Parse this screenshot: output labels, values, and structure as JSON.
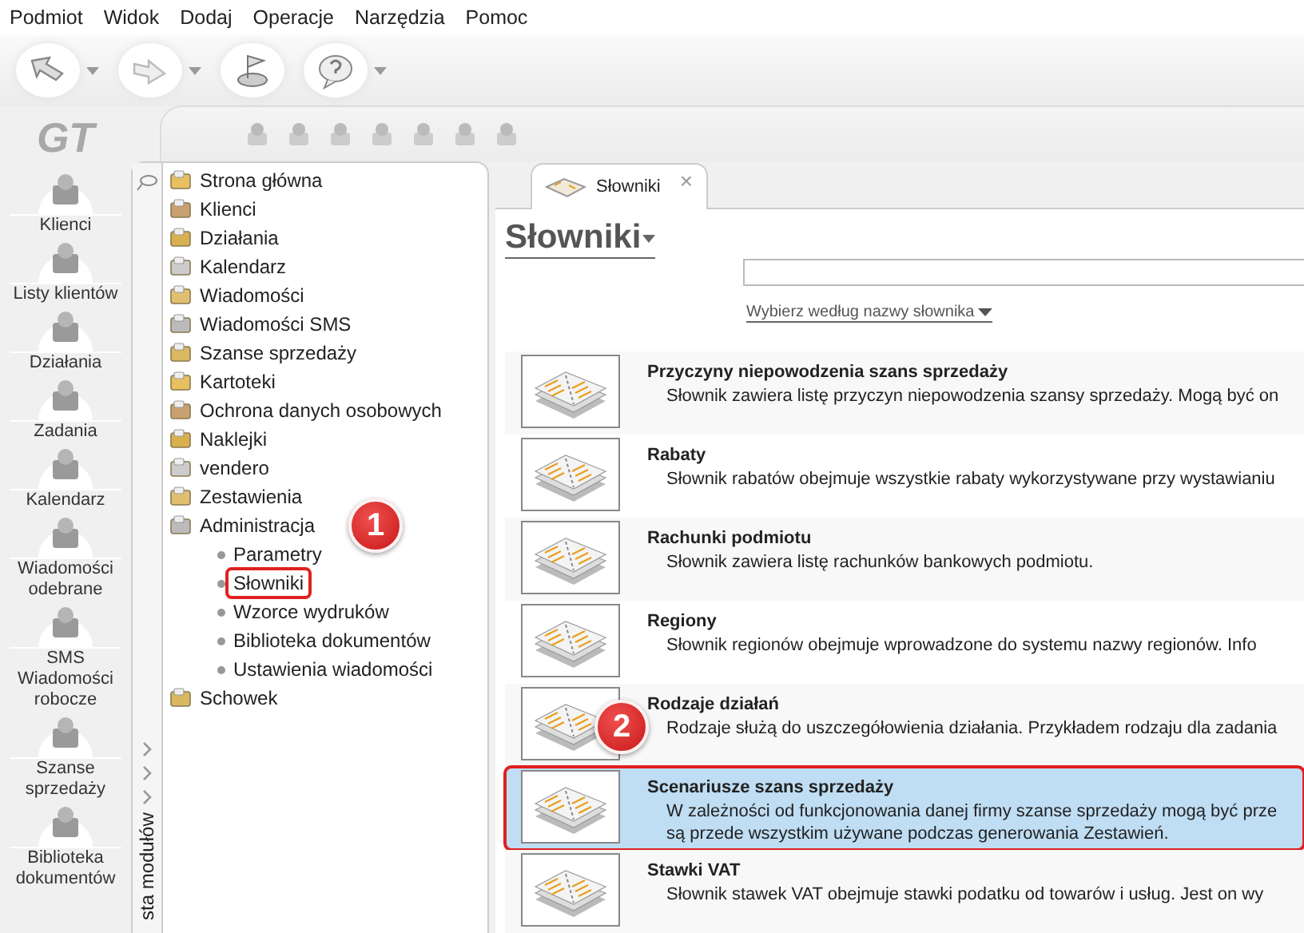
{
  "menu": [
    "Podmiot",
    "Widok",
    "Dodaj",
    "Operacje",
    "Narzędzia",
    "Pomoc"
  ],
  "toolbar": [
    {
      "dropdown": true
    },
    {
      "dropdown": true
    },
    {
      "dropdown": false
    },
    {
      "dropdown": true
    }
  ],
  "logo": "GT",
  "rail": [
    "Klienci",
    "Listy klientów",
    "Działania",
    "Zadania",
    "Kalendarz",
    "Wiadomości odebrane",
    "SMS Wiadomości robocze",
    "Szanse sprzedaży",
    "Biblioteka dokumentów"
  ],
  "module_strip": {
    "label": "sta modułów"
  },
  "tree": [
    {
      "label": "Strona główna"
    },
    {
      "label": "Klienci"
    },
    {
      "label": "Działania"
    },
    {
      "label": "Kalendarz"
    },
    {
      "label": "Wiadomości"
    },
    {
      "label": "Wiadomości SMS"
    },
    {
      "label": "Szanse sprzedaży"
    },
    {
      "label": "Kartoteki"
    },
    {
      "label": "Ochrona danych osobowych"
    },
    {
      "label": "Naklejki"
    },
    {
      "label": "vendero"
    },
    {
      "label": "Zestawienia"
    },
    {
      "label": "Administracja",
      "badge": "1",
      "children": [
        {
          "label": "Parametry",
          "outlined": false
        },
        {
          "label": "Słowniki",
          "outlined": true
        },
        {
          "label": "Wzorce wydruków",
          "outlined": false
        },
        {
          "label": "Biblioteka dokumentów",
          "outlined": false
        },
        {
          "label": "Ustawienia wiadomości",
          "outlined": false
        }
      ]
    },
    {
      "label": "Schowek"
    }
  ],
  "tab": {
    "label": "Słowniki",
    "close": "×"
  },
  "heading": "Słowniki",
  "filter": {
    "label": "Wybierz według nazwy słownika"
  },
  "dictionaries": [
    {
      "title": "Przyczyny niepowodzenia szans sprzedaży",
      "description": [
        "Słownik zawiera listę przyczyn niepowodzenia szansy sprzedaży. Mogą być on"
      ],
      "selected": false,
      "outlined": false
    },
    {
      "title": "Rabaty",
      "description": [
        "Słownik rabatów obejmuje wszystkie rabaty wykorzystywane przy wystawianiu"
      ],
      "selected": false,
      "outlined": false
    },
    {
      "title": "Rachunki podmiotu",
      "description": [
        "Słownik zawiera listę rachunków bankowych podmiotu."
      ],
      "selected": false,
      "outlined": false
    },
    {
      "title": "Regiony",
      "description": [
        "Słownik regionów obejmuje wprowadzone do systemu nazwy regionów. Info"
      ],
      "selected": false,
      "outlined": false
    },
    {
      "title": "Rodzaje działań",
      "description": [
        "Rodzaje służą do uszczegółowienia działania. Przykładem rodzaju dla zadania"
      ],
      "selected": false,
      "outlined": false,
      "badge": "2"
    },
    {
      "title": "Scenariusze szans sprzedaży",
      "description": [
        "W zależności od funkcjonowania danej firmy szanse sprzedaży mogą być prze",
        "są przede wszystkim używane podczas generowania Zestawień."
      ],
      "selected": true,
      "outlined": true
    },
    {
      "title": "Stawki VAT",
      "description": [
        "Słownik stawek VAT obejmuje stawki podatku od towarów i usług. Jest on wy"
      ],
      "selected": false,
      "outlined": false
    }
  ]
}
